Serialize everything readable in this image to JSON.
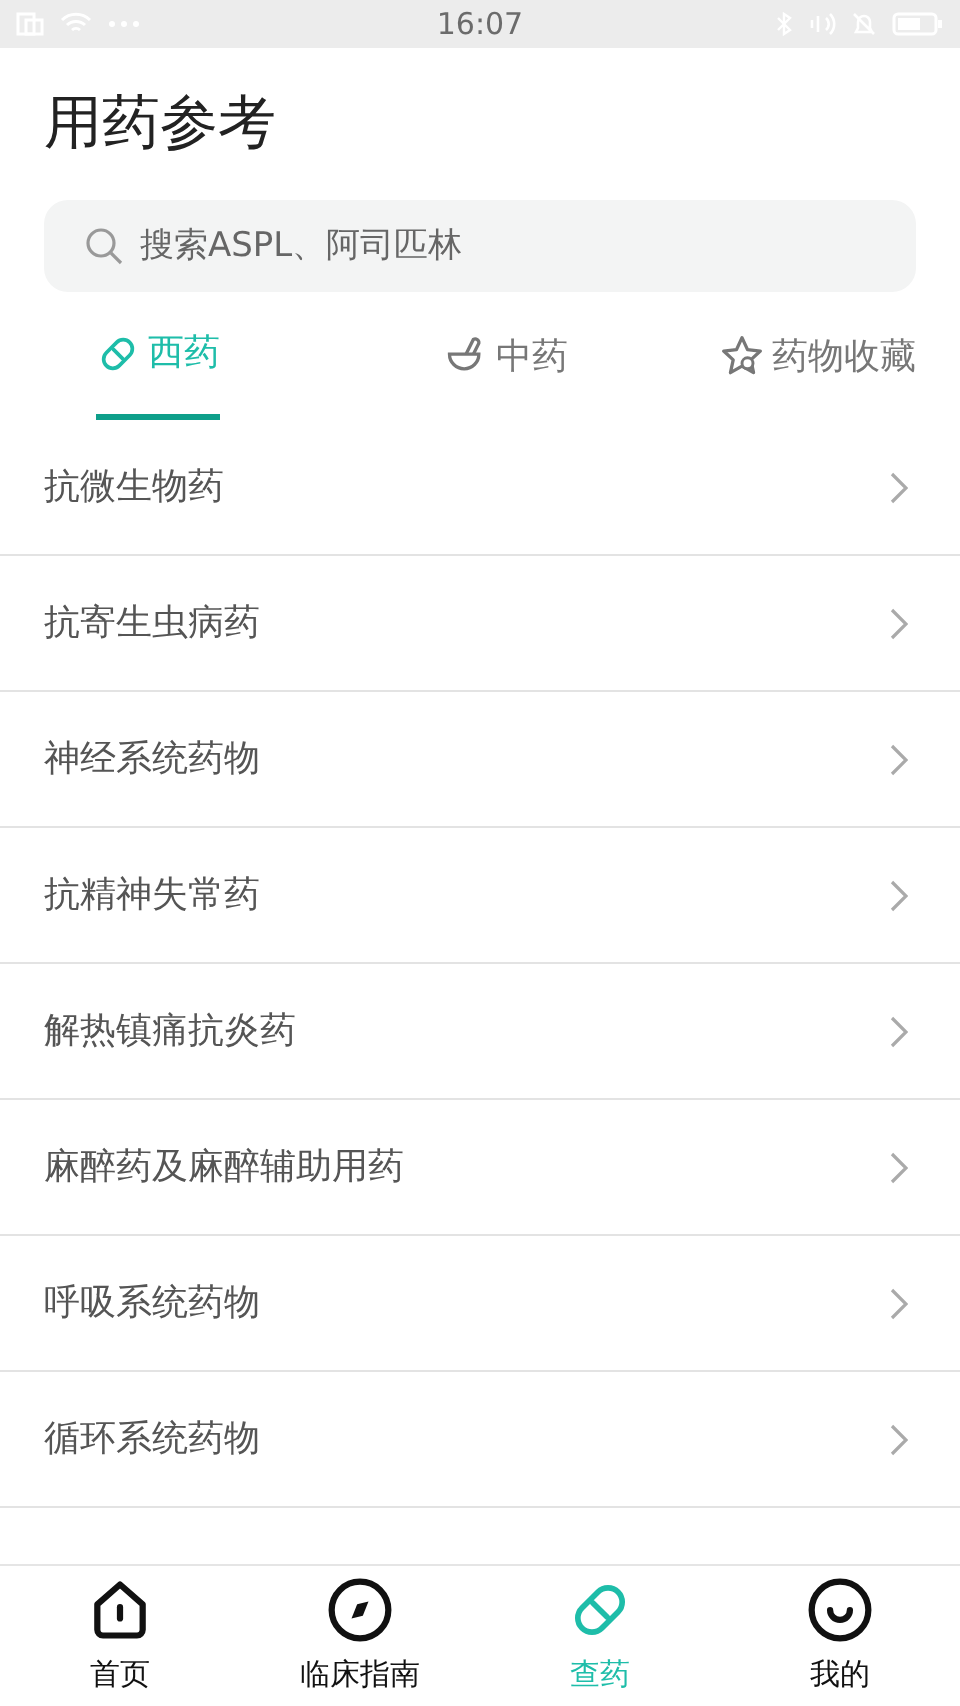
{
  "status_bar": {
    "time": "16:07"
  },
  "title": "用药参考",
  "search": {
    "placeholder": "搜索ASPL、阿司匹林"
  },
  "tabs": [
    {
      "label": "西药",
      "selected": true
    },
    {
      "label": "中药",
      "selected": false
    },
    {
      "label": "药物收藏",
      "selected": false
    }
  ],
  "categories": [
    {
      "label": "抗微生物药"
    },
    {
      "label": "抗寄生虫病药"
    },
    {
      "label": "神经系统药物"
    },
    {
      "label": "抗精神失常药"
    },
    {
      "label": "解热镇痛抗炎药"
    },
    {
      "label": "麻醉药及麻醉辅助用药"
    },
    {
      "label": "呼吸系统药物"
    },
    {
      "label": "循环系统药物"
    }
  ],
  "bottom_nav": [
    {
      "label": "首页",
      "selected": false
    },
    {
      "label": "临床指南",
      "selected": false
    },
    {
      "label": "查药",
      "selected": true
    },
    {
      "label": "我的",
      "selected": false
    }
  ]
}
